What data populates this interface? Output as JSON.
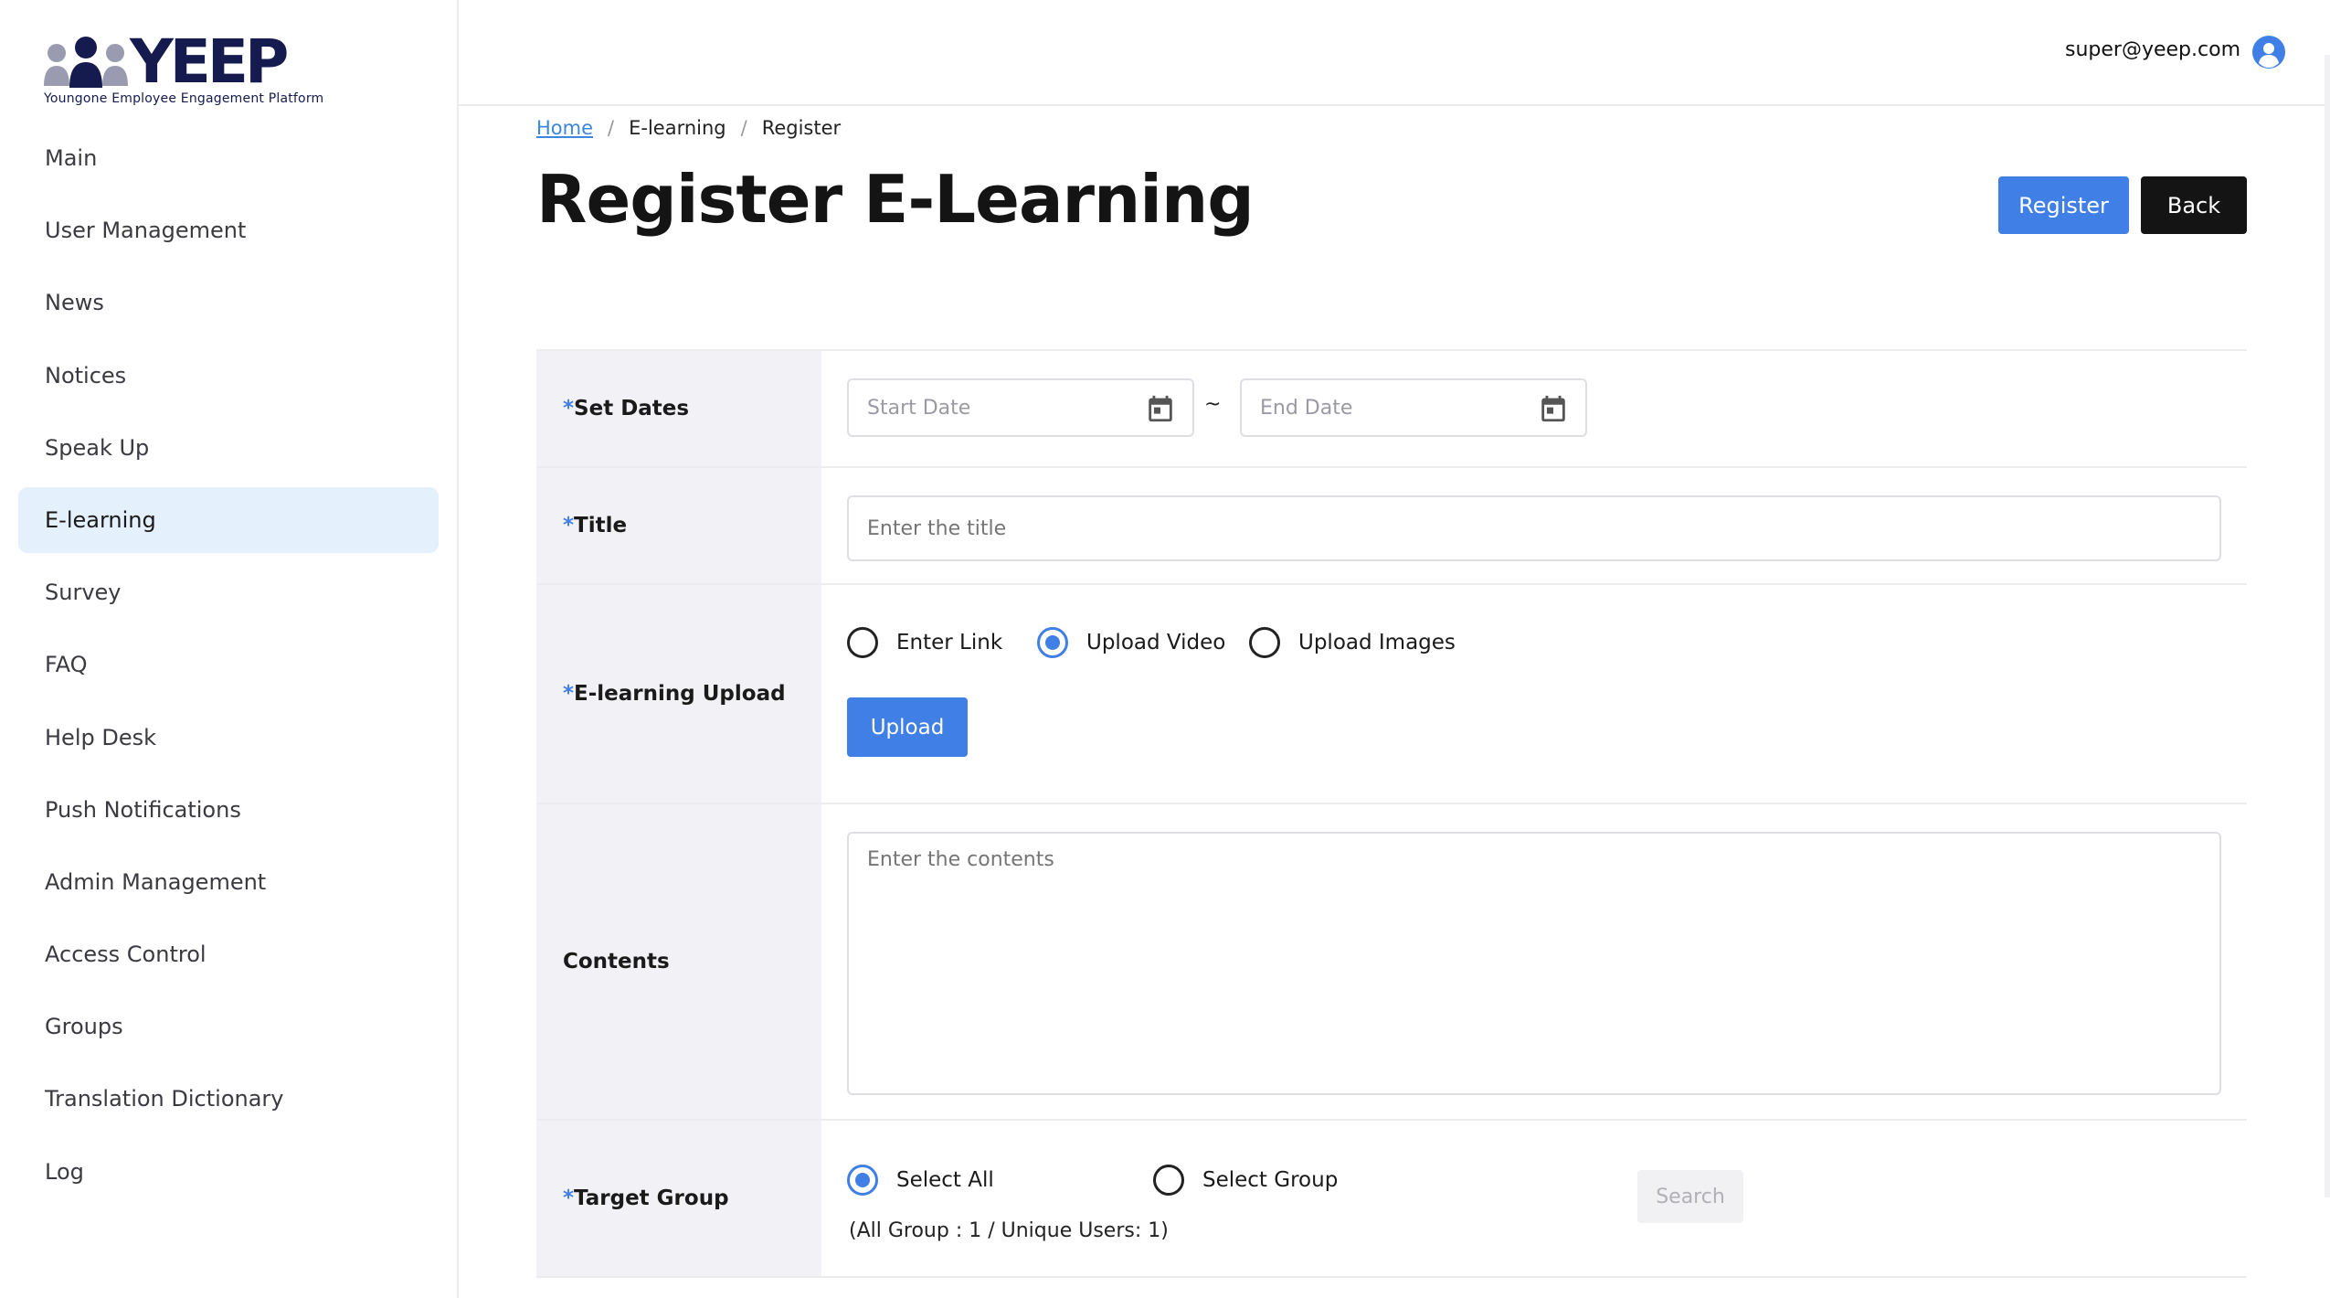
{
  "app": {
    "logo_word": "YEEP",
    "logo_tagline": "Youngone Employee Engagement Platform"
  },
  "sidebar": {
    "items": [
      {
        "label": "Main"
      },
      {
        "label": "User Management"
      },
      {
        "label": "News"
      },
      {
        "label": "Notices"
      },
      {
        "label": "Speak Up"
      },
      {
        "label": "E-learning",
        "active": true
      },
      {
        "label": "Survey"
      },
      {
        "label": "FAQ"
      },
      {
        "label": "Help Desk"
      },
      {
        "label": "Push Notifications"
      },
      {
        "label": "Admin Management"
      },
      {
        "label": "Access Control"
      },
      {
        "label": "Groups"
      },
      {
        "label": "Translation Dictionary"
      },
      {
        "label": "Log"
      }
    ]
  },
  "header": {
    "user_email": "super@yeep.com",
    "user_icon": "user-circle-icon"
  },
  "breadcrumb": {
    "home": "Home",
    "section": "E-learning",
    "current": "Register",
    "separator": "/"
  },
  "page": {
    "title": "Register E-Learning",
    "register_button": "Register",
    "back_button": "Back"
  },
  "form": {
    "required_mark": "*",
    "set_dates": {
      "label": "Set Dates",
      "start_placeholder": "Start Date",
      "end_placeholder": "End Date",
      "range_separator": "~",
      "icon": "calendar-icon"
    },
    "title": {
      "label": "Title",
      "placeholder": "Enter the title"
    },
    "upload": {
      "label": "E-learning Upload",
      "options": [
        "Enter Link",
        "Upload Video",
        "Upload Images"
      ],
      "selected": "Upload Video",
      "button": "Upload"
    },
    "contents": {
      "label": "Contents",
      "placeholder": "Enter the contents"
    },
    "target_group": {
      "label": "Target Group",
      "options": [
        "Select All",
        "Select Group"
      ],
      "selected": "Select All",
      "search_button": "Search",
      "info": "(All Group : 1 / Unique Users: 1)"
    }
  },
  "colors": {
    "accent": "#3f7fe6",
    "brand_navy": "#151b4e",
    "active_menu_bg": "#e5f0fd",
    "label_bg": "#f2f2f6"
  }
}
